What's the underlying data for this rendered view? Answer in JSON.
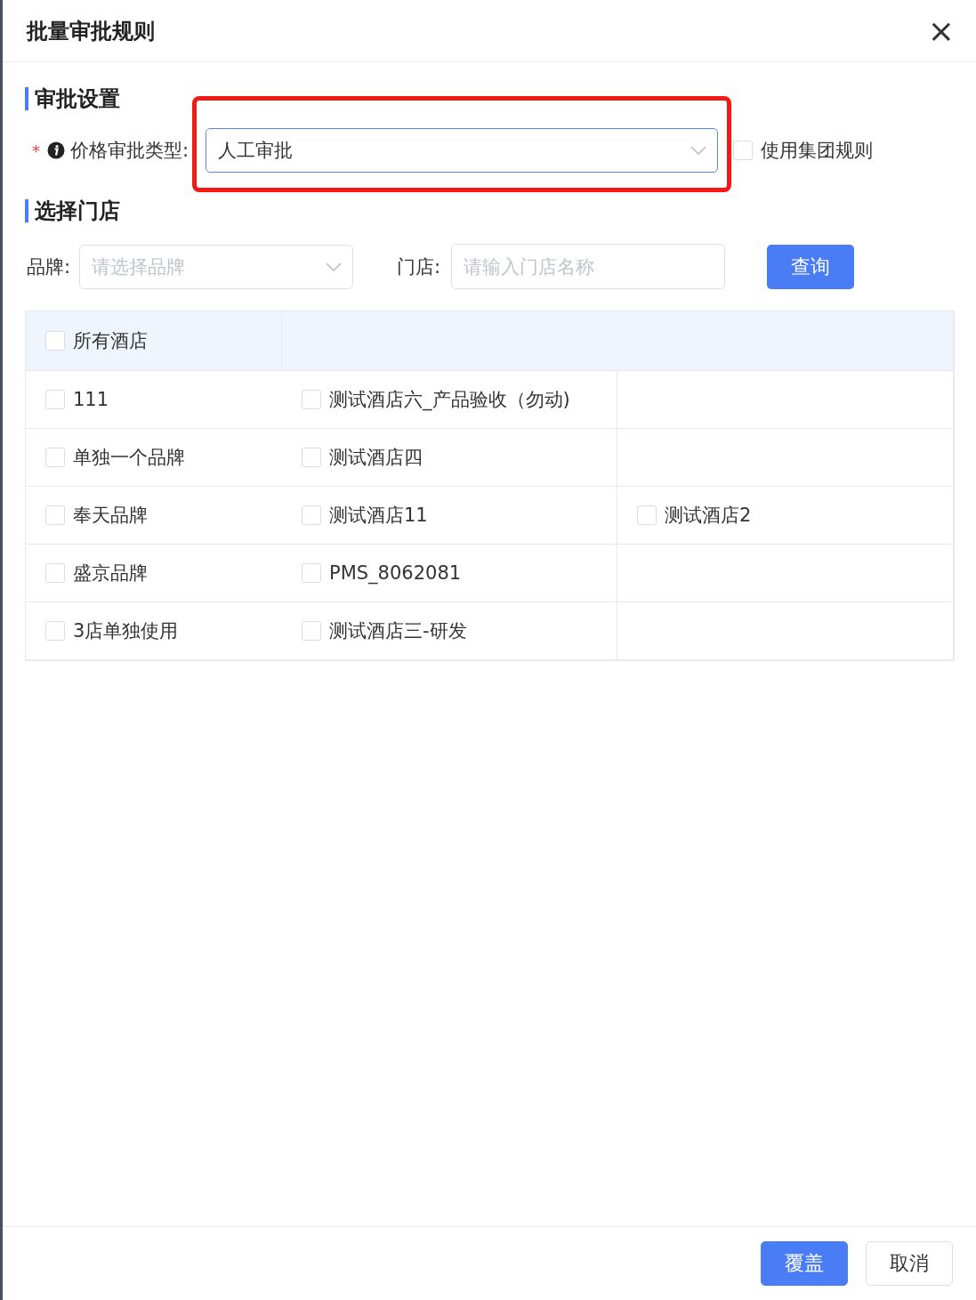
{
  "dialog": {
    "title": "批量审批规则",
    "close": "×"
  },
  "approval_section": {
    "title": "审批设置",
    "field": {
      "required_mark": "*",
      "label": "价格审批类型",
      "colon": ":",
      "value": "人工审批",
      "highlighted": true
    },
    "group_rule": {
      "label": "使用集团规则",
      "checked": false
    }
  },
  "store_section": {
    "title": "选择门店",
    "brand_filter": {
      "label": "品牌:",
      "placeholder": "请选择品牌"
    },
    "store_filter": {
      "label": "门店:",
      "placeholder": "请输入门店名称"
    },
    "query_button": "查询",
    "all_hotels": {
      "label": "所有酒店",
      "checked": false
    },
    "rows": [
      {
        "brand": {
          "label": "111",
          "checked": false
        },
        "stores": [
          {
            "label": "测试酒店六_产品验收（勿动)",
            "checked": false
          }
        ]
      },
      {
        "brand": {
          "label": "单独一个品牌",
          "checked": false
        },
        "stores": [
          {
            "label": "测试酒店四",
            "checked": false
          }
        ]
      },
      {
        "brand": {
          "label": "奉天品牌",
          "checked": false
        },
        "stores": [
          {
            "label": "测试酒店11",
            "checked": false
          },
          {
            "label": "测试酒店2",
            "checked": false
          }
        ]
      },
      {
        "brand": {
          "label": "盛京品牌",
          "checked": false
        },
        "stores": [
          {
            "label": "PMS_8062081",
            "checked": false
          }
        ]
      },
      {
        "brand": {
          "label": "3店单独使用",
          "checked": false
        },
        "stores": [
          {
            "label": "测试酒店三-研发",
            "checked": false
          }
        ]
      }
    ]
  },
  "footer": {
    "buttons": [
      {
        "label": "覆盖",
        "kind": "primary"
      },
      {
        "label": "取消",
        "kind": "default"
      }
    ]
  }
}
